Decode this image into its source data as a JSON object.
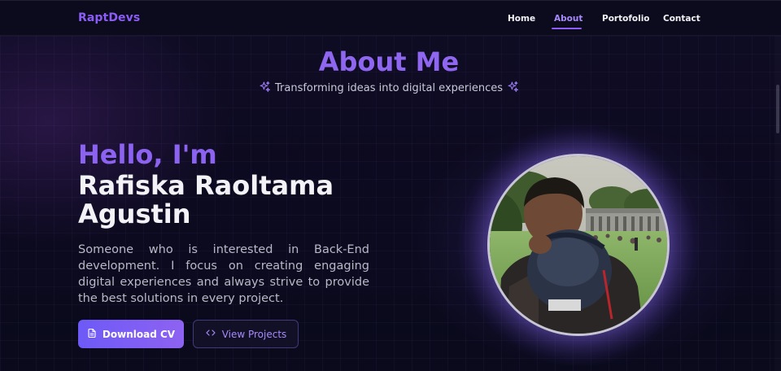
{
  "nav": {
    "logo": "RaptDevs",
    "links": [
      {
        "label": "Home",
        "active": false
      },
      {
        "label": "About",
        "active": true
      },
      {
        "label": "Portofolio",
        "active": false
      },
      {
        "label": "Contact",
        "active": false
      }
    ]
  },
  "about": {
    "title": "About Me",
    "subtitle": "Transforming ideas into digital experiences"
  },
  "hero": {
    "greeting": "Hello, I'm",
    "name": "Rafiska Raoltama Agustin",
    "bio": "Someone who is interested in Back-End development. I focus on creating engaging digital experiences and always strive to provide the best solutions in every project."
  },
  "buttons": {
    "download_cv": "Download CV",
    "view_projects": "View Projects"
  },
  "icons": {
    "sparkle": "sparkle-icon",
    "document": "document-icon",
    "code": "code-icon"
  },
  "colors": {
    "accent": "#8b5cf6",
    "background": "#0c0a1f",
    "text": "#f2f2f7"
  }
}
